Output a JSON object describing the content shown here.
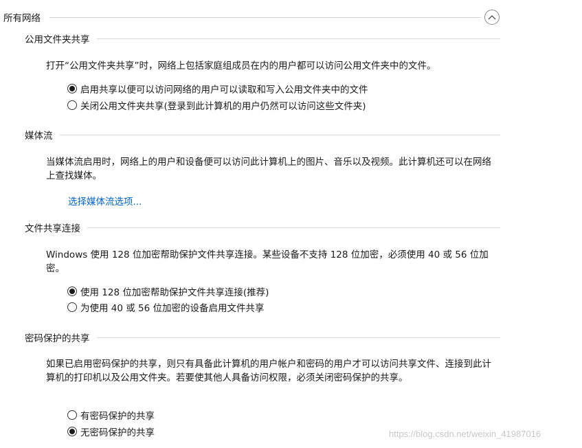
{
  "header": {
    "title": "所有网络"
  },
  "public_folder": {
    "title": "公用文件夹共享",
    "description": "打开“公用文件夹共享”时，网络上包括家庭组成员在内的用户都可以访问公用文件夹中的文件。",
    "options": [
      {
        "label": "启用共享以便可以访问网络的用户可以读取和写入公用文件夹中的文件",
        "checked": true
      },
      {
        "label": "关闭公用文件夹共享(登录到此计算机的用户仍然可以访问这些文件夹)",
        "checked": false
      }
    ]
  },
  "media": {
    "title": "媒体流",
    "description": "当媒体流启用时，网络上的用户和设备便可以访问此计算机上的图片、音乐以及视频。此计算机还可以在网络上查找媒体。",
    "link": "选择媒体流选项..."
  },
  "file_sharing": {
    "title": "文件共享连接",
    "description": "Windows 使用 128 位加密帮助保护文件共享连接。某些设备不支持 128 位加密，必须使用 40 或 56 位加密。",
    "options": [
      {
        "label": "使用 128 位加密帮助保护文件共享连接(推荐)",
        "checked": true
      },
      {
        "label": "为使用 40 或 56 位加密的设备启用文件共享",
        "checked": false
      }
    ]
  },
  "password": {
    "title": "密码保护的共享",
    "description": "如果已启用密码保护的共享，则只有具备此计算机的用户帐户和密码的用户才可以访问共享文件、连接到此计算机的打印机以及公用文件夹。若要使其他人具备访问权限，必须关闭密码保护的共享。",
    "options": [
      {
        "label": "有密码保护的共享",
        "checked": false
      },
      {
        "label": "无密码保护的共享",
        "checked": true
      }
    ]
  },
  "watermark": "https://blog.csdn.net/weixin_41987016",
  "colors": {
    "link": "#0066cc",
    "divider": "#d6d6d6",
    "text": "#1a1a1a"
  },
  "icons": {
    "collapse": "chevron-up-icon"
  }
}
